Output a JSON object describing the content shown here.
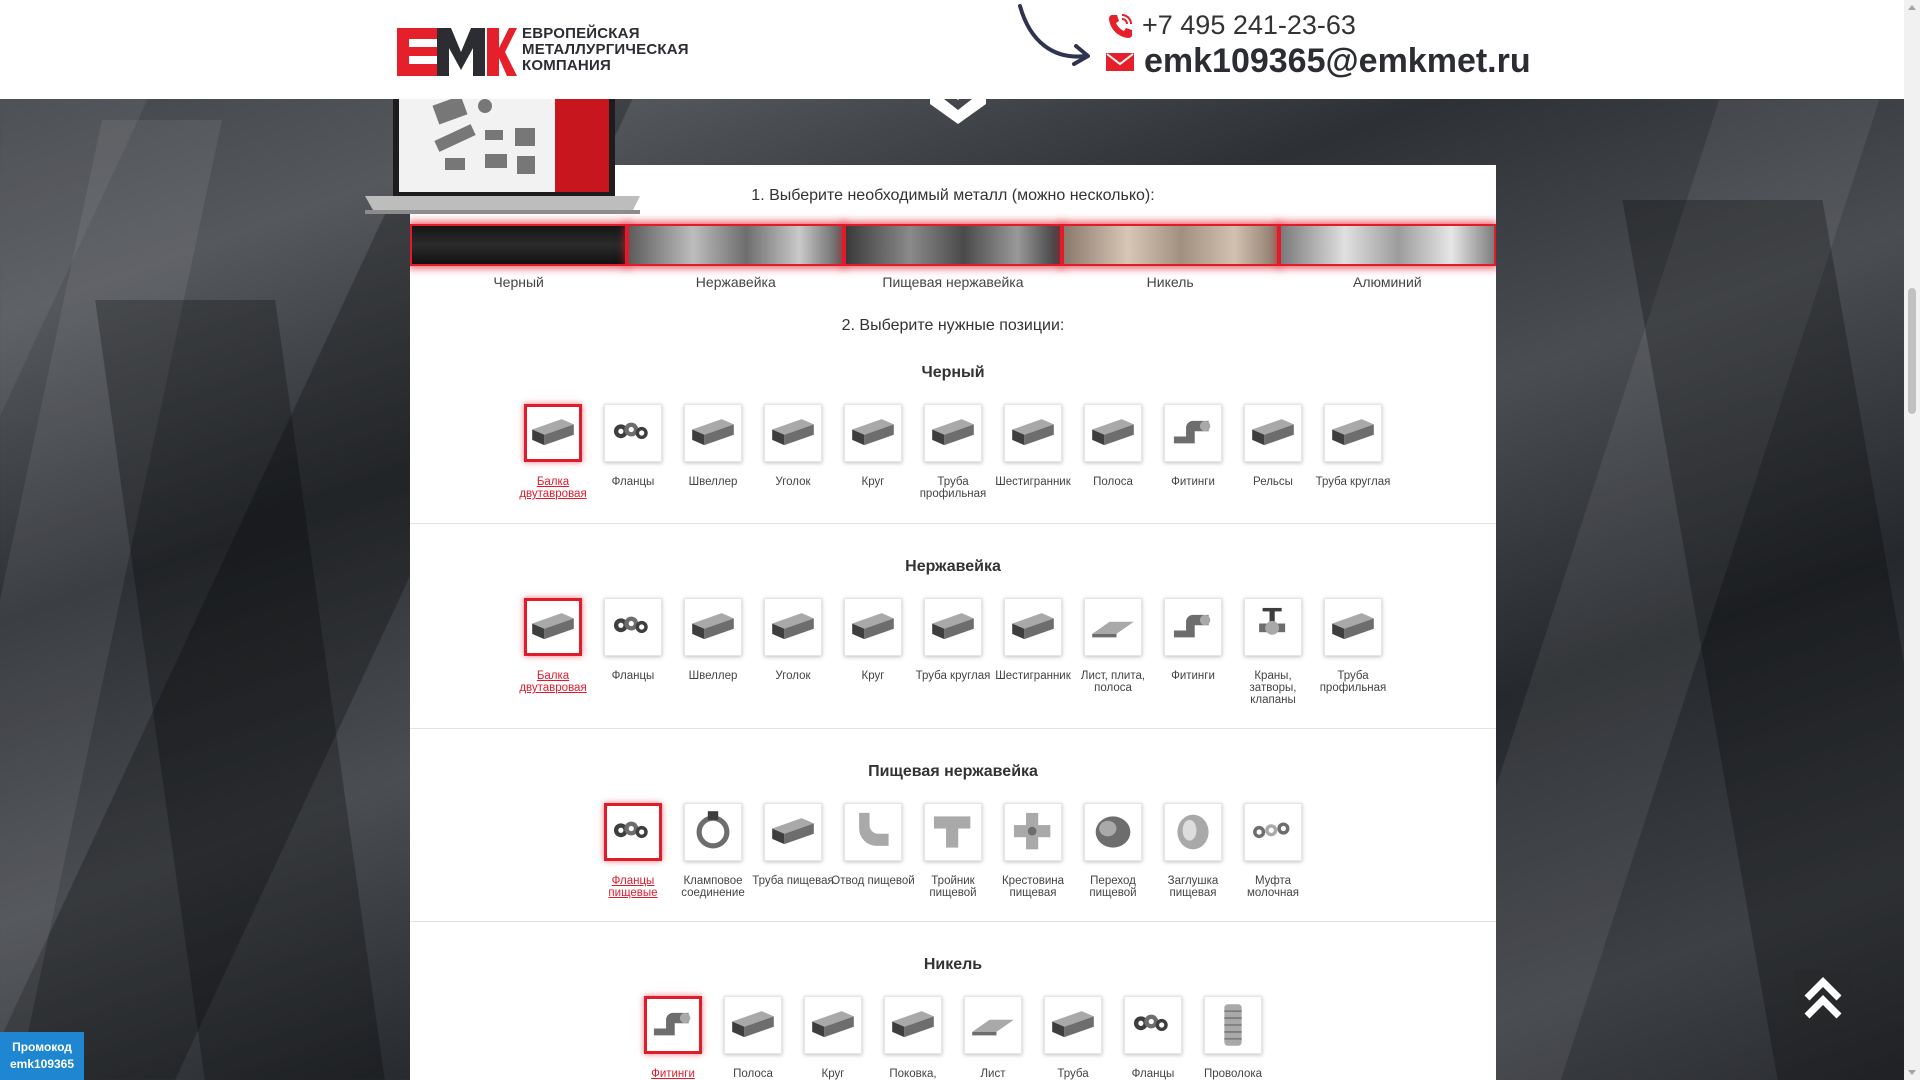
{
  "header": {
    "logo_text": [
      "ЕВРОПЕЙСКАЯ",
      "МЕТАЛЛУРГИЧЕСКАЯ",
      "КОМПАНИЯ"
    ],
    "phone": "+7 495 241-23-63",
    "email": "emk109365@emkmet.ru"
  },
  "step1": "1. Выберите необходимый металл (можно несколько):",
  "step2": "2. Выберите нужные позиции:",
  "metals": [
    {
      "label": "Черный",
      "gradient": "linear-gradient(#151515,#2b2b2b 50%,#111)"
    },
    {
      "label": "Нержавейка",
      "gradient": "linear-gradient(90deg,#5c5c5c,#bdbdbd 30%,#6e6e6e 55%,#c9c9c9 80%,#606060)"
    },
    {
      "label": "Пищевая нержавейка",
      "gradient": "linear-gradient(90deg,#3a3a3a,#8a8a8a 30%,#4a4a4a 55%,#999 80%,#3c3c3c)"
    },
    {
      "label": "Никель",
      "gradient": "linear-gradient(90deg,#8a7a6c,#d8c6b6 30%,#a18f80 55%,#d2c0b0 80%,#8c7b6c)"
    },
    {
      "label": "Алюминий",
      "gradient": "linear-gradient(90deg,#7a7a7a,#e0e0e0 30%,#9c9c9c 55%,#e6e6e6 80%,#7e7e7e)"
    }
  ],
  "sections": [
    {
      "title": "Черный",
      "items": [
        {
          "name": "Балка двутавровая",
          "selected": true,
          "icon": "i-beam-icon"
        },
        {
          "name": "Фланцы",
          "icon": "flanges-icon"
        },
        {
          "name": "Швеллер",
          "icon": "channel-icon"
        },
        {
          "name": "Уголок",
          "icon": "angle-icon"
        },
        {
          "name": "Круг",
          "icon": "round-bar-icon"
        },
        {
          "name": "Труба профильная",
          "icon": "profile-pipe-icon"
        },
        {
          "name": "Шестигранник",
          "icon": "hexagon-bar-icon"
        },
        {
          "name": "Полоса",
          "icon": "strip-icon"
        },
        {
          "name": "Фитинги",
          "icon": "fittings-icon"
        },
        {
          "name": "Рельсы",
          "icon": "rails-icon"
        },
        {
          "name": "Труба круглая",
          "icon": "round-pipe-icon"
        }
      ]
    },
    {
      "title": "Нержавейка",
      "items": [
        {
          "name": "Балка двутавровая",
          "selected": true,
          "icon": "i-beam-icon"
        },
        {
          "name": "Фланцы",
          "icon": "flanges-icon"
        },
        {
          "name": "Швеллер",
          "icon": "channel-icon"
        },
        {
          "name": "Уголок",
          "icon": "angle-icon"
        },
        {
          "name": "Круг",
          "icon": "round-bar-icon"
        },
        {
          "name": "Труба круглая",
          "icon": "round-pipe-icon"
        },
        {
          "name": "Шестигранник",
          "icon": "hexagon-bar-icon"
        },
        {
          "name": "Лист, плита, полоса",
          "icon": "sheet-icon"
        },
        {
          "name": "Фитинги",
          "icon": "fittings-icon"
        },
        {
          "name": "Краны, затворы, клапаны",
          "icon": "valve-icon"
        },
        {
          "name": "Труба профильная",
          "icon": "profile-pipe-icon"
        }
      ]
    },
    {
      "title": "Пищевая нержавейка",
      "items": [
        {
          "name": "Фланцы пищевые",
          "selected": true,
          "icon": "flanges-icon"
        },
        {
          "name": "Кламповое соединение",
          "icon": "clamp-icon"
        },
        {
          "name": "Труба пищевая",
          "icon": "round-pipe-icon"
        },
        {
          "name": "Отвод пищевой",
          "icon": "elbow-icon"
        },
        {
          "name": "Тройник пищевой",
          "icon": "tee-icon"
        },
        {
          "name": "Крестовина пищевая",
          "icon": "cross-icon"
        },
        {
          "name": "Переход пищевой",
          "icon": "reducer-icon"
        },
        {
          "name": "Заглушка пищевая",
          "icon": "cap-icon"
        },
        {
          "name": "Муфта молочная",
          "icon": "coupling-icon"
        }
      ]
    },
    {
      "title": "Никель",
      "items": [
        {
          "name": "Фитинги",
          "selected": true,
          "icon": "fittings-icon"
        },
        {
          "name": "Полоса",
          "icon": "strip-icon"
        },
        {
          "name": "Круг",
          "icon": "round-bar-icon"
        },
        {
          "name": "Поковка,",
          "icon": "forging-icon"
        },
        {
          "name": "Лист",
          "icon": "sheet-icon"
        },
        {
          "name": "Труба",
          "icon": "round-pipe-icon"
        },
        {
          "name": "Фланцы",
          "icon": "flanges-icon"
        },
        {
          "name": "Проволока",
          "icon": "wire-icon"
        }
      ]
    }
  ],
  "promo": {
    "line1": "Промокод",
    "line2": "emk109365"
  },
  "colors": {
    "accent": "#e21b2b",
    "promo_bg": "#1f86d1",
    "logo_red": "#e5202b",
    "logo_dark": "#2b2d32"
  }
}
